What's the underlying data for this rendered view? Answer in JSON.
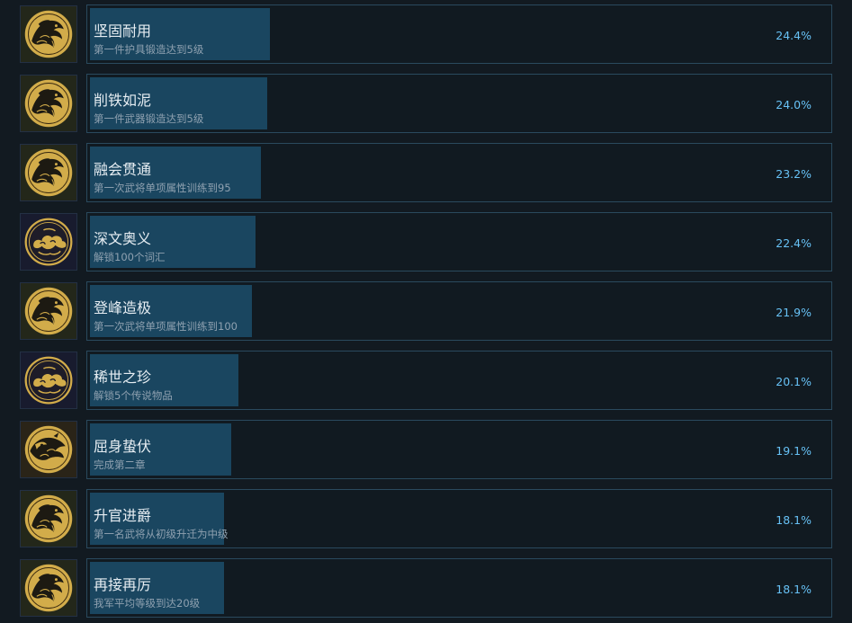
{
  "achievements": [
    {
      "name": "坚固耐用",
      "description": "第一件护具锻造达到5级",
      "percent": "24.4%",
      "fill": 0.244,
      "icon": "gold-phoenix-medallion-icon",
      "icon_bg": "olive"
    },
    {
      "name": "削铁如泥",
      "description": "第一件武器锻造达到5级",
      "percent": "24.0%",
      "fill": 0.24,
      "icon": "gold-phoenix-medallion-icon",
      "icon_bg": "olive"
    },
    {
      "name": "融会贯通",
      "description": "第一次武将单项属性训练到95",
      "percent": "23.2%",
      "fill": 0.232,
      "icon": "gold-phoenix-medallion-icon",
      "icon_bg": "olive"
    },
    {
      "name": "深文奥义",
      "description": "解锁100个词汇",
      "percent": "22.4%",
      "fill": 0.224,
      "icon": "gold-cloud-medallion-icon",
      "icon_bg": "navy"
    },
    {
      "name": "登峰造极",
      "description": "第一次武将单项属性训练到100",
      "percent": "21.9%",
      "fill": 0.219,
      "icon": "gold-phoenix-medallion-icon",
      "icon_bg": "olive"
    },
    {
      "name": "稀世之珍",
      "description": "解锁5个传说物品",
      "percent": "20.1%",
      "fill": 0.201,
      "icon": "gold-cloud-medallion-icon",
      "icon_bg": "navy"
    },
    {
      "name": "屈身蛰伏",
      "description": "完成第二章",
      "percent": "19.1%",
      "fill": 0.191,
      "icon": "gold-beast-medallion-icon",
      "icon_bg": "brown"
    },
    {
      "name": "升官进爵",
      "description": "第一名武将从初级升迁为中级",
      "percent": "18.1%",
      "fill": 0.181,
      "icon": "gold-phoenix-medallion-icon",
      "icon_bg": "olive"
    },
    {
      "name": "再接再厉",
      "description": "我军平均等级到达20级",
      "percent": "18.1%",
      "fill": 0.181,
      "icon": "gold-phoenix-medallion-icon",
      "icon_bg": "olive"
    }
  ],
  "colors": {
    "background": "#121a21",
    "bar_fill": "#1a4660",
    "panel_border": "#2a4a5e",
    "percent_text": "#67c1f5",
    "medallion_gold": "#d2ac4a"
  }
}
